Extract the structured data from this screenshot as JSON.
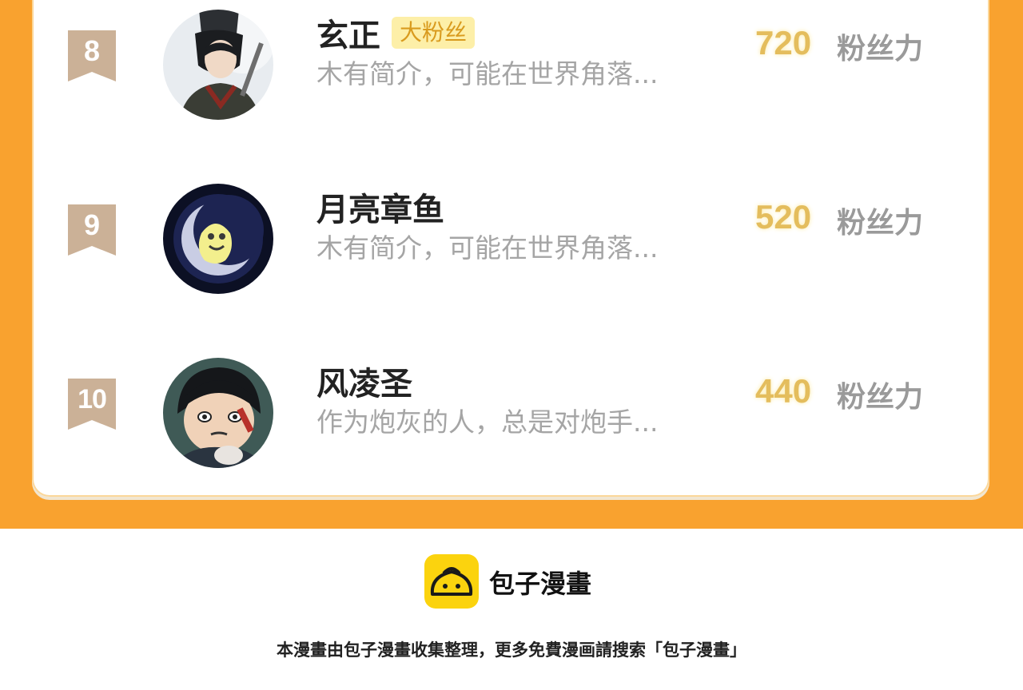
{
  "ranking": {
    "unit_label": "粉丝力",
    "rows": [
      {
        "rank": "8",
        "name": "玄正",
        "tag": "大粉丝",
        "desc": "木有简介，可能在世界角落...",
        "score": "720",
        "avatar": "avatar-samurai-boy"
      },
      {
        "rank": "9",
        "name": "月亮章鱼",
        "tag": "",
        "desc": "木有简介，可能在世界角落...",
        "score": "520",
        "avatar": "avatar-moon-octopus"
      },
      {
        "rank": "10",
        "name": "风凌圣",
        "tag": "",
        "desc": "作为炮灰的人，总是对炮手...",
        "score": "440",
        "avatar": "avatar-anime-boy"
      }
    ]
  },
  "footer": {
    "brand": "包子漫畫",
    "note": "本漫畫由包子漫畫收集整理，更多免費漫画請搜索「包子漫畫」",
    "logo_icon": "baozi-bun-icon"
  },
  "colors": {
    "orange": "#f9a22f",
    "badge": "#cbb197",
    "score": "#e4bd5d",
    "tag_bg": "#fdefa8"
  }
}
